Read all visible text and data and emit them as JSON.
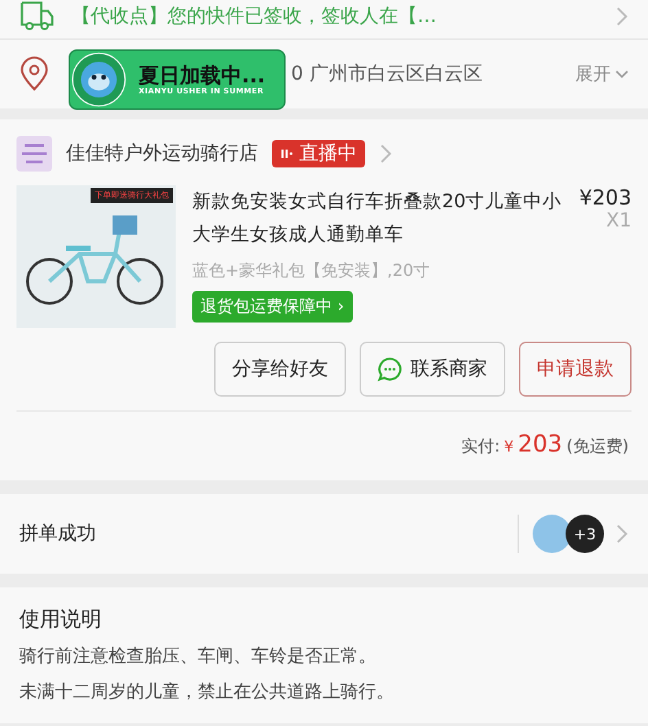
{
  "delivery": {
    "text": "【代收点】您的快件已签收，签收人在【…"
  },
  "address": {
    "text": "0 广州市白云区白云区",
    "expand": "展开"
  },
  "promo_badge": {
    "title": "夏日加载中...",
    "subtitle": "XIANYU USHER IN SUMMER"
  },
  "shop": {
    "name": "佳佳特户外运动骑行店",
    "live": true,
    "live_label": "直播中"
  },
  "product": {
    "image_banner": "下单即送骑行大礼包",
    "title": "新款免安装女式自行车折叠款20寸儿童中小大学生女孩成人通勤单车",
    "price": "¥203",
    "quantity": "X1",
    "spec": "蓝色+豪华礼包【免安装】,20寸",
    "guarantee": "退货包运费保障中",
    "guarantee_arrow": "›"
  },
  "buttons": [
    {
      "label": "分享给好友",
      "kind": "plain"
    },
    {
      "label": "联系商家",
      "kind": "chat"
    },
    {
      "label": "申请退款",
      "kind": "primary"
    }
  ],
  "payment": {
    "label": "实付:",
    "currency": "¥",
    "amount": "203",
    "note": "(免运费)"
  },
  "group": {
    "label": "拼单成功",
    "extra_count": "+3"
  },
  "instructions": {
    "title": "使用说明",
    "lines": [
      "骑行前注意检查胎压、车闸、车铃是否正常。",
      "未满十二周岁的儿童，禁止在公共道路上骑行。"
    ]
  }
}
